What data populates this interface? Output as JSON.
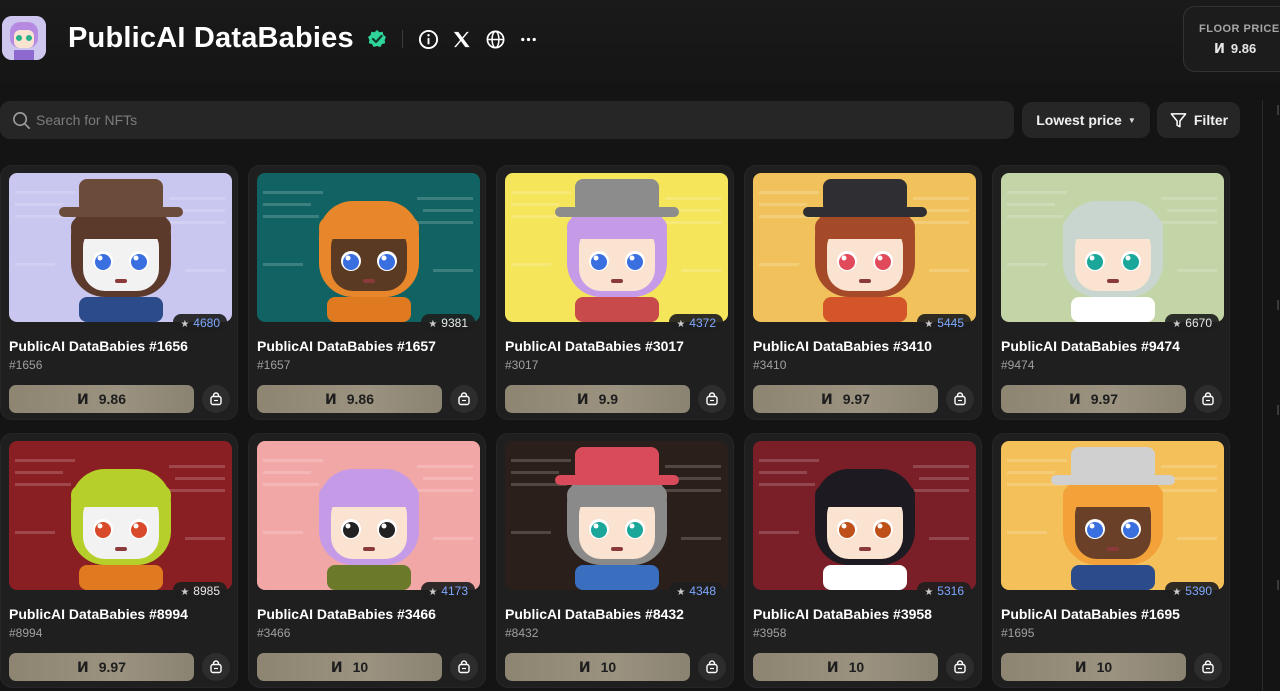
{
  "header": {
    "title": "PublicAI DataBabies",
    "floor_label": "FLOOR PRICE",
    "floor_currency": "Ͷ",
    "floor_value": "9.86"
  },
  "toolbar": {
    "search_placeholder": "Search for NFTs",
    "sort_label": "Lowest price",
    "filter_label": "Filter"
  },
  "currency_symbol": "Ͷ",
  "nfts": [
    {
      "name": "PublicAI DataBabies #1656",
      "id": "#1656",
      "rank": "4680",
      "price": "9.86",
      "rank_color": "blue",
      "bg": "#c9c6ef",
      "skin": "#f2f2f2",
      "hair": "#5b3a2c",
      "hat": "#6b4b3a",
      "eye": "#3a6fe0",
      "shirt": "#2b4b8a"
    },
    {
      "name": "PublicAI DataBabies #1657",
      "id": "#1657",
      "rank": "9381",
      "price": "9.86",
      "rank_color": "white",
      "bg": "#116363",
      "skin": "#5a3a22",
      "hair": "#e7862a",
      "hat": "",
      "eye": "#3a6fe0",
      "shirt": "#e07a20"
    },
    {
      "name": "PublicAI DataBabies #3017",
      "id": "#3017",
      "rank": "4372",
      "price": "9.9",
      "rank_color": "blue",
      "bg": "#f4e55a",
      "skin": "#fbe3d2",
      "hair": "#c59be8",
      "hat": "#8c8c8c",
      "eye": "#3a6fe0",
      "shirt": "#c94a4a"
    },
    {
      "name": "PublicAI DataBabies #3410",
      "id": "#3410",
      "rank": "5445",
      "price": "9.97",
      "rank_color": "blue",
      "bg": "#f1c25b",
      "skin": "#fbe3d2",
      "hair": "#a54a28",
      "hat": "#2f2f33",
      "eye": "#e04a5a",
      "shirt": "#d4552a"
    },
    {
      "name": "PublicAI DataBabies #9474",
      "id": "#9474",
      "rank": "6670",
      "price": "9.97",
      "rank_color": "white",
      "bg": "#c3d4a6",
      "skin": "#fbe3d2",
      "hair": "#c9d6d0",
      "hat": "",
      "eye": "#1aa79a",
      "shirt": "#ffffff"
    },
    {
      "name": "PublicAI DataBabies #8994",
      "id": "#8994",
      "rank": "8985",
      "price": "9.97",
      "rank_color": "white",
      "bg": "#8a1f23",
      "skin": "#f2f2f2",
      "hair": "#b7cf2a",
      "hat": "",
      "eye": "#d94a2a",
      "shirt": "#e07a20"
    },
    {
      "name": "PublicAI DataBabies #3466",
      "id": "#3466",
      "rank": "4173",
      "price": "10",
      "rank_color": "blue",
      "bg": "#f2a7a7",
      "skin": "#fbe3d2",
      "hair": "#c59be8",
      "hat": "",
      "eye": "#222222",
      "shirt": "#6b7a2a"
    },
    {
      "name": "PublicAI DataBabies #8432",
      "id": "#8432",
      "rank": "4348",
      "price": "10",
      "rank_color": "blue",
      "bg": "#2a1f1a",
      "skin": "#fbe3d2",
      "hair": "#8a8a8a",
      "hat": "#d94a5a",
      "eye": "#1aa79a",
      "shirt": "#3a6fc0"
    },
    {
      "name": "PublicAI DataBabies #3958",
      "id": "#3958",
      "rank": "5316",
      "price": "10",
      "rank_color": "blue",
      "bg": "#7a1f28",
      "skin": "#fbe3d2",
      "hair": "#1e1a22",
      "hat": "",
      "eye": "#c0501a",
      "shirt": "#ffffff"
    },
    {
      "name": "PublicAI DataBabies #1695",
      "id": "#1695",
      "rank": "5390",
      "price": "10",
      "rank_color": "blue",
      "bg": "#f3c05a",
      "skin": "#6a4028",
      "hair": "#f3a23a",
      "hat": "#d0d0d0",
      "eye": "#3a6fe0",
      "shirt": "#2b4b8a"
    }
  ]
}
